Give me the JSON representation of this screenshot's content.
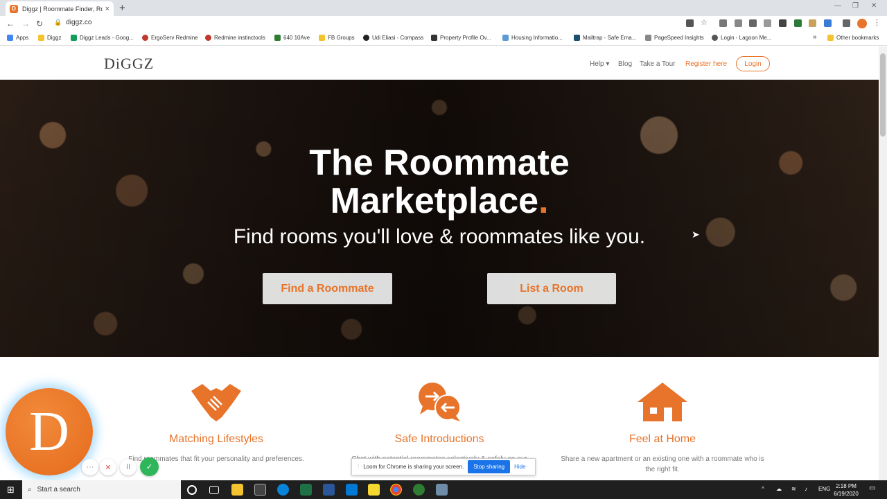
{
  "browser": {
    "tab_title": "Diggz | Roommate Finder, Room",
    "tab_favicon_letter": "D",
    "new_tab": "+",
    "url": "diggz.co",
    "window_controls": {
      "minimize": "—",
      "restore": "❐",
      "close": "✕"
    },
    "nav": {
      "back": "←",
      "forward": "→",
      "reload": "↻"
    },
    "bookmarks": [
      "Apps",
      "Diggz",
      "Diggz Leads - Goog...",
      "ErgoServ Redmine",
      "Redmine instinctools",
      "640 10Ave",
      "FB Groups",
      "Udi Eliasi - Compass",
      "Property Profile Ov...",
      "Housing Informatio...",
      "Mailtrap - Safe Ema...",
      "PageSpeed Insights",
      "Login - Lagoon Me..."
    ],
    "bookmarks_more": "»",
    "other_bookmarks": "Other bookmarks"
  },
  "header": {
    "logo": "DiGGZ",
    "menu": {
      "help": "Help ▾",
      "blog": "Blog",
      "tour": "Take a Tour",
      "register": "Register here",
      "login": "Login"
    }
  },
  "hero": {
    "title_line1": "The Roommate",
    "title_line2": "Marketplace",
    "title_dot": ".",
    "subtitle": "Find rooms you'll love & roommates like you.",
    "btn_find": "Find a Roommate",
    "btn_list": "List a Room"
  },
  "features": [
    {
      "title": "Matching Lifestyles",
      "text": "Find roommates that fit your personality and preferences.",
      "icon": "handshake-icon"
    },
    {
      "title": "Safe Introductions",
      "text": "Chat with potential roommates selectively & safely on our",
      "icon": "chat-bubbles-icon"
    },
    {
      "title": "Feel at Home",
      "text": "Share a new apartment or an existing one with a roommate who is the right fit.",
      "icon": "house-icon"
    }
  ],
  "loom": {
    "avatar_letter": "D",
    "share_text": "Loom for Chrome is sharing your screen.",
    "stop": "Stop sharing",
    "hide": "Hide",
    "controls": {
      "more": "···",
      "cancel": "✕",
      "pause": "II",
      "done": "✓"
    }
  },
  "taskbar": {
    "search": "Start a search",
    "lang": "ENG",
    "time": "2:18 PM",
    "date": "6/19/2020"
  },
  "colors": {
    "accent": "#e8732a"
  }
}
